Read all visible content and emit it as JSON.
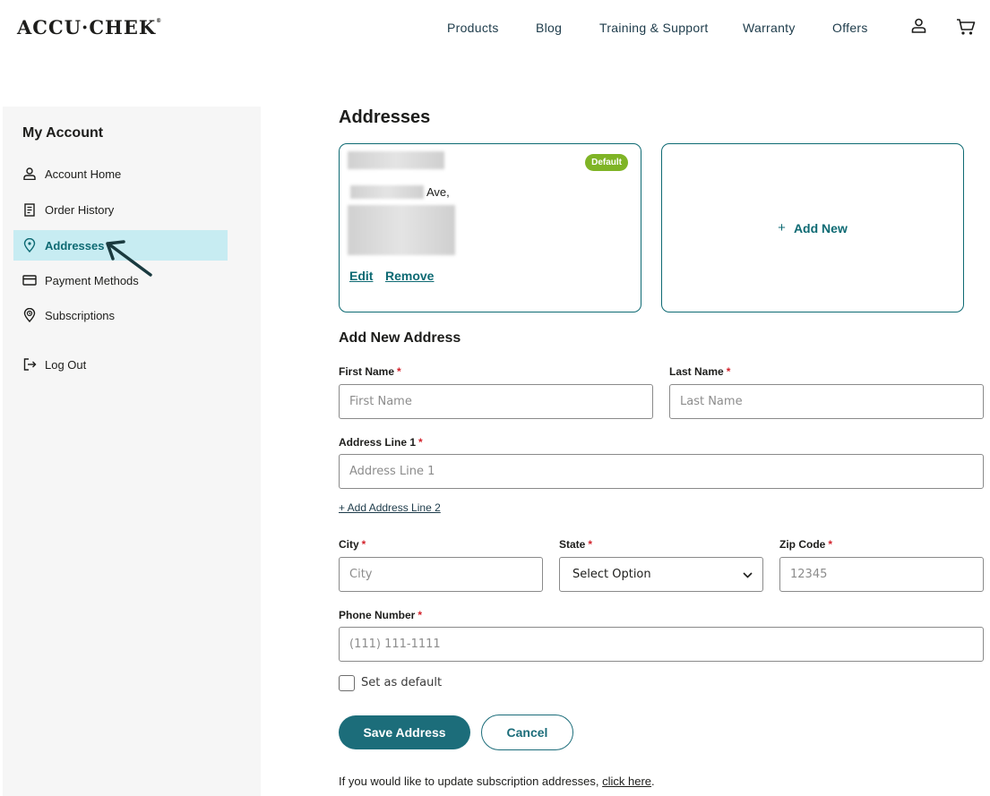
{
  "header": {
    "logo": "ACCU·CHEK",
    "logo_mark": "®",
    "nav": [
      "Products",
      "Blog",
      "Training & Support",
      "Warranty",
      "Offers"
    ],
    "icons": [
      "account-icon",
      "cart-icon"
    ]
  },
  "sidebar": {
    "title": "My Account",
    "items": [
      {
        "label": "Account Home",
        "icon": "person-icon",
        "active": false
      },
      {
        "label": "Order History",
        "icon": "receipt-icon",
        "active": false
      },
      {
        "label": "Addresses",
        "icon": "location-pin-icon",
        "active": true
      },
      {
        "label": "Payment Methods",
        "icon": "credit-card-icon",
        "active": false
      },
      {
        "label": "Subscriptions",
        "icon": "subscription-icon",
        "active": false
      },
      {
        "label": "Log Out",
        "icon": "logout-icon",
        "active": false
      }
    ]
  },
  "main": {
    "title": "Addresses",
    "saved_address": {
      "badge": "Default",
      "street_suffix": "Ave,",
      "edit_label": "Edit",
      "remove_label": "Remove"
    },
    "add_new_label": "Add New",
    "form": {
      "title": "Add New Address",
      "first_name": {
        "label": "First Name",
        "placeholder": "First Name",
        "value": ""
      },
      "last_name": {
        "label": "Last Name",
        "placeholder": "Last Name",
        "value": ""
      },
      "address1": {
        "label": "Address Line 1",
        "placeholder": "Address Line 1",
        "value": ""
      },
      "add_line2_label": "+ Add Address Line 2",
      "city": {
        "label": "City",
        "placeholder": "City",
        "value": ""
      },
      "state": {
        "label": "State",
        "selected": "Select Option"
      },
      "zip": {
        "label": "Zip Code",
        "placeholder": "12345",
        "value": ""
      },
      "phone": {
        "label": "Phone Number",
        "placeholder": "(111) 111-1111",
        "value": ""
      },
      "default_checkbox_label": "Set as default",
      "default_checked": false,
      "save_label": "Save Address",
      "cancel_label": "Cancel",
      "required_mark": "*"
    },
    "footnote": {
      "text": "If you would like to update subscription addresses, ",
      "link": "click here",
      "end": "."
    }
  },
  "colors": {
    "accent": "#0e6a73",
    "button": "#1c6d7a",
    "active_bg": "#c7ecf2",
    "badge": "#7fb426",
    "required": "#d3232c"
  }
}
